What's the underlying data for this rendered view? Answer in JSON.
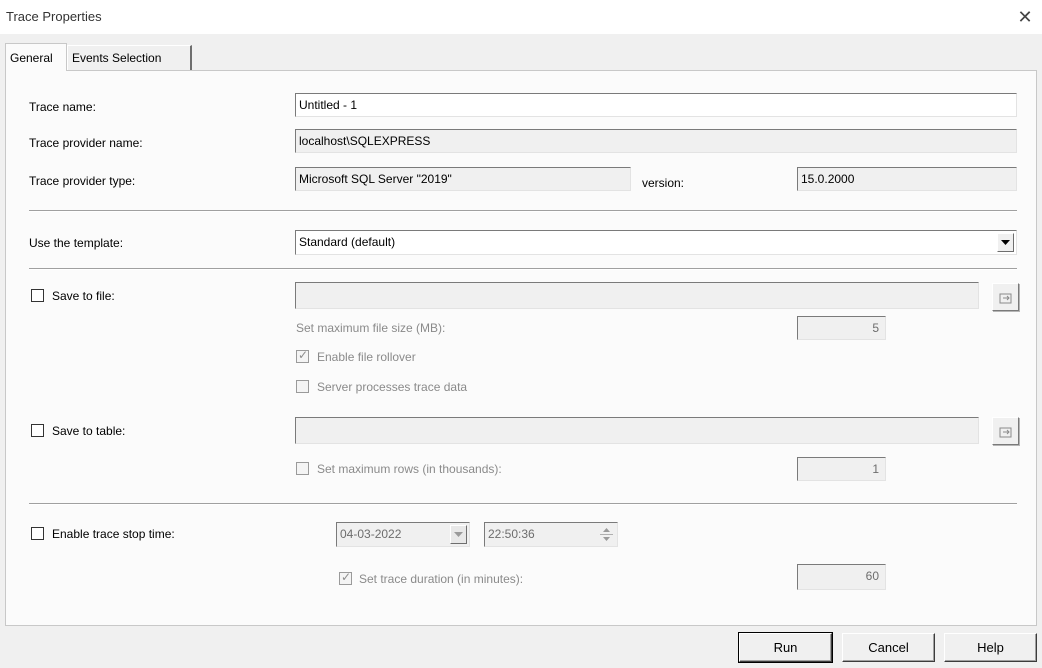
{
  "window": {
    "title": "Trace Properties",
    "close_glyph": "✕"
  },
  "tabs": [
    {
      "label": "General",
      "active": true
    },
    {
      "label": "Events Selection",
      "active": false
    }
  ],
  "general": {
    "trace_name": {
      "label": "Trace name:",
      "value": "Untitled - 1"
    },
    "provider_name": {
      "label": "Trace provider name:",
      "value": "localhost\\SQLEXPRESS"
    },
    "provider_type": {
      "label": "Trace provider type:",
      "value": "Microsoft SQL Server \"2019\"",
      "version_label": "version:",
      "version_value": "15.0.2000"
    },
    "template": {
      "label": "Use the template:",
      "value": "Standard (default)"
    },
    "save_to_file": {
      "label": "Save to file:",
      "checked": false,
      "path": "",
      "max_size_label": "Set maximum file size (MB):",
      "max_size_value": "5",
      "rollover_label": "Enable file rollover",
      "rollover_checked": true,
      "server_process_label": "Server processes trace data",
      "server_process_checked": false
    },
    "save_to_table": {
      "label": "Save to table:",
      "checked": false,
      "table": "",
      "max_rows_label": "Set maximum rows (in thousands):",
      "max_rows_checked": false,
      "max_rows_value": "1"
    },
    "stop_time": {
      "label": "Enable trace stop time:",
      "checked": false,
      "date": "04-03-2022",
      "time": "22:50:36",
      "duration_label": "Set trace duration (in minutes):",
      "duration_checked": true,
      "duration_value": "60"
    }
  },
  "buttons": {
    "run": "Run",
    "cancel": "Cancel",
    "help": "Help"
  },
  "icons": {
    "browse": "browse-folder-icon",
    "dropdown": "chevron-down-icon"
  }
}
